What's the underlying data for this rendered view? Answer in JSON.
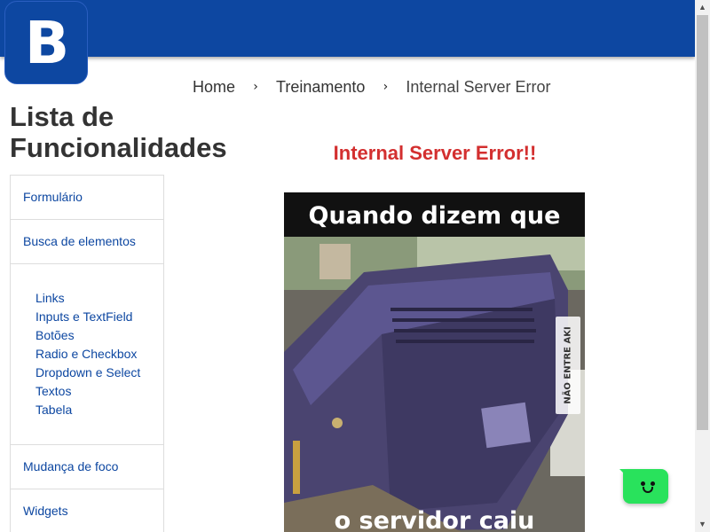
{
  "brand": {
    "logo_letter": "B"
  },
  "breadcrumb": {
    "items": [
      "Home",
      "Treinamento",
      "Internal Server Error"
    ],
    "separator": "›"
  },
  "sidebar": {
    "title": "Lista de Funcionalidades",
    "items": [
      {
        "label": "Formulário"
      },
      {
        "label": "Busca de elementos"
      }
    ],
    "subitems": [
      "Links",
      "Inputs e TextField",
      "Botões",
      "Radio e Checkbox",
      "Dropdown e Select",
      "Textos",
      "Tabela"
    ],
    "items_after": [
      {
        "label": "Mudança de foco"
      },
      {
        "label": "Widgets"
      }
    ]
  },
  "main": {
    "error_title": "Internal Server Error!!",
    "meme": {
      "top_text": "Quando dizem que",
      "bottom_text": "o servidor caiu",
      "watermark": "NÃO ENTRE AKI"
    }
  },
  "colors": {
    "topbar": "#0d47a1",
    "link": "#0d47a1",
    "error": "#d32f2f",
    "chat": "#29e25c"
  },
  "icons": {
    "breadcrumb_separator": "chevron-right-icon",
    "chat": "chat-bot-icon",
    "scroll_up": "arrow-up-icon",
    "scroll_down": "arrow-down-icon"
  }
}
